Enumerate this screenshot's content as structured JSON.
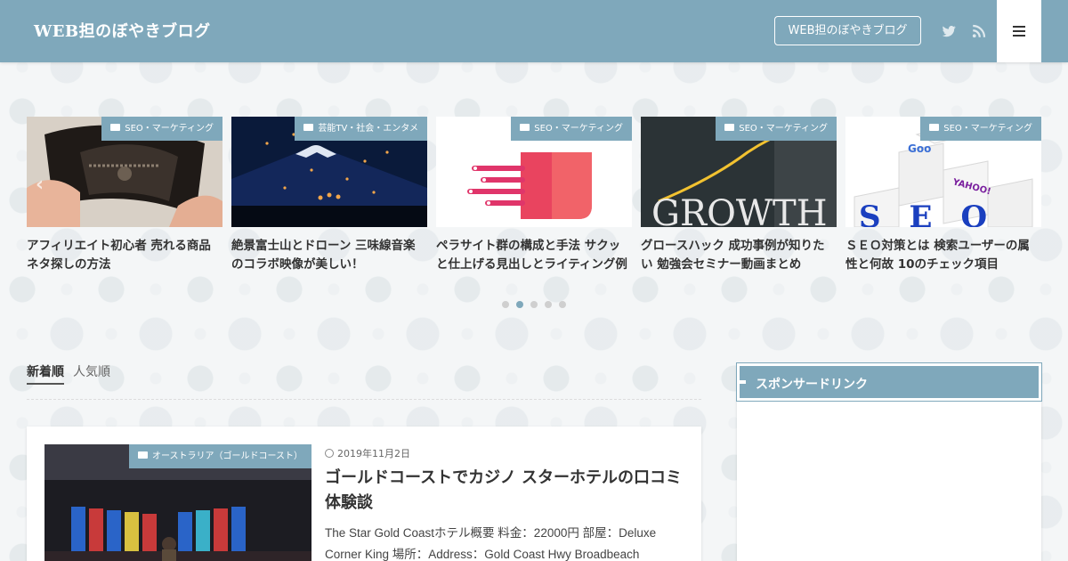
{
  "header": {
    "site_title": "WEB担のぼやきブログ",
    "button_label": "WEB担のぼやきブログ",
    "bg_color": "#7fa8bb",
    "icons": [
      "twitter-icon",
      "rss-icon",
      "menu-icon"
    ]
  },
  "carousel": {
    "items": [
      {
        "category": "SEO・マーケティング",
        "title": "アフィリエイト初心者 売れる商品ネタ探しの方法"
      },
      {
        "category": "芸能TV・社会・エンタメ",
        "title": "絶景富士山とドローン 三味線音楽のコラボ映像が美しい！"
      },
      {
        "category": "SEO・マーケティング",
        "title": "ペラサイト群の構成と手法 サクッと仕上げる見出しとライティング例"
      },
      {
        "category": "SEO・マーケティング",
        "title": "グロースハック 成功事例が知りたい 勉強会セミナー動画まとめ"
      },
      {
        "category": "SEO・マーケティング",
        "title": "ＳＥＯ対策とは 検索ユーザーの属性と何故 10のチェック項目"
      }
    ],
    "pager": {
      "count": 5,
      "active_index": 1
    },
    "growth_text": "GROWTH",
    "seo_letters": "SEO"
  },
  "tabs": [
    {
      "label": "新着順",
      "active": true
    },
    {
      "label": "人気順",
      "active": false
    }
  ],
  "post": {
    "category": "オーストラリア（ゴールドコースト）",
    "date": "2019年11月2日",
    "title": "ゴールドコーストでカジノ スターホテルの口コミ体験談",
    "excerpt": "The Star Gold Coastホテル概要 料金：22000円 部屋：Deluxe Corner King 場所：Address：Gold Coast Hwy Broadbeach"
  },
  "sidebar": {
    "widget_title": "スポンサードリンク"
  }
}
